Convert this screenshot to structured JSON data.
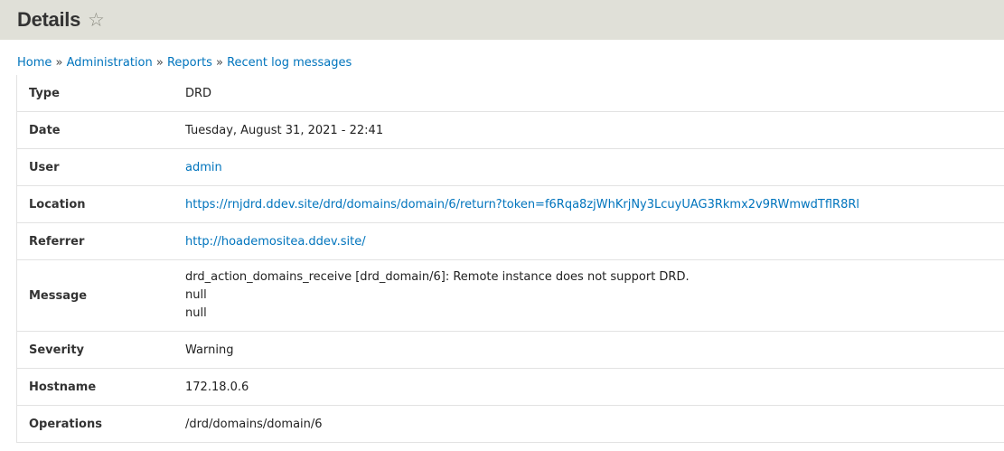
{
  "header": {
    "title": "Details",
    "star_icon": "star-outline-icon"
  },
  "breadcrumb": [
    "Home",
    "Administration",
    "Reports",
    "Recent log messages"
  ],
  "rows": {
    "type": {
      "label": "Type",
      "value": "DRD"
    },
    "date": {
      "label": "Date",
      "value": "Tuesday, August 31, 2021 - 22:41"
    },
    "user": {
      "label": "User",
      "value": "admin"
    },
    "location": {
      "label": "Location",
      "value": "https://rnjdrd.ddev.site/drd/domains/domain/6/return?token=f6Rqa8zjWhKrjNy3LcuyUAG3Rkmx2v9RWmwdTflR8Rl"
    },
    "referrer": {
      "label": "Referrer",
      "value": "http://hoademositea.ddev.site/"
    },
    "message": {
      "label": "Message",
      "lines": [
        "drd_action_domains_receive [drd_domain/6]: Remote instance does not support DRD.",
        "null",
        "null"
      ]
    },
    "severity": {
      "label": "Severity",
      "value": "Warning"
    },
    "hostname": {
      "label": "Hostname",
      "value": "172.18.0.6"
    },
    "operations": {
      "label": "Operations",
      "value": "/drd/domains/domain/6"
    }
  }
}
